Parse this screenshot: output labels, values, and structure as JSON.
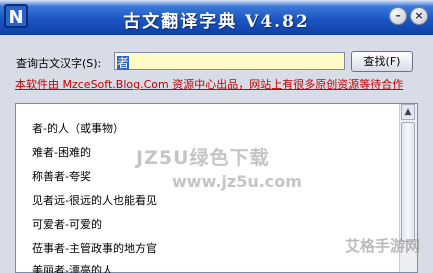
{
  "window": {
    "logo_glyph": "N",
    "title": "古文翻译字典 V4.82",
    "minimize_glyph": "–",
    "close_glyph": "×"
  },
  "search": {
    "label": "查询古文汉字(S):",
    "value": "者",
    "button_label": "查找(F)"
  },
  "banner": {
    "text": "本软件由 MzceSoft.Blog.Com 资源中心出品，网站上有很多原创资源等待合作"
  },
  "results": {
    "items": [
      "者-的人（或事物）",
      "难者-困难的",
      "称善者-夸奖",
      "见者远-很远的人也能看见",
      "可爱者-可爱的",
      "莅事者-主管政事的地方官",
      "美丽者-漂亮的人"
    ]
  },
  "watermarks": {
    "brand": "JZ5U绿色下载",
    "url": "www.jz5u.com",
    "corner": "艾格手游网"
  },
  "colors": {
    "title_bar": "#1c56c4",
    "input_bg": "#fffbc6",
    "banner_text": "#c40000"
  }
}
